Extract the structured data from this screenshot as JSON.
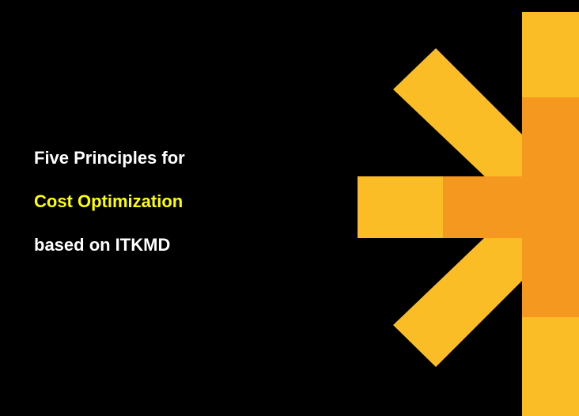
{
  "title": {
    "line1": "Five Principles for",
    "line2": "Cost Optimization",
    "line3": "based on ITKMD"
  },
  "colors": {
    "background": "#000000",
    "text_primary": "#ffffff",
    "text_highlight": "#ffff00",
    "logo_yellow": "#fbbd26",
    "logo_orange": "#f5981f"
  },
  "logo": {
    "icon": "sunburst-logo-icon"
  }
}
